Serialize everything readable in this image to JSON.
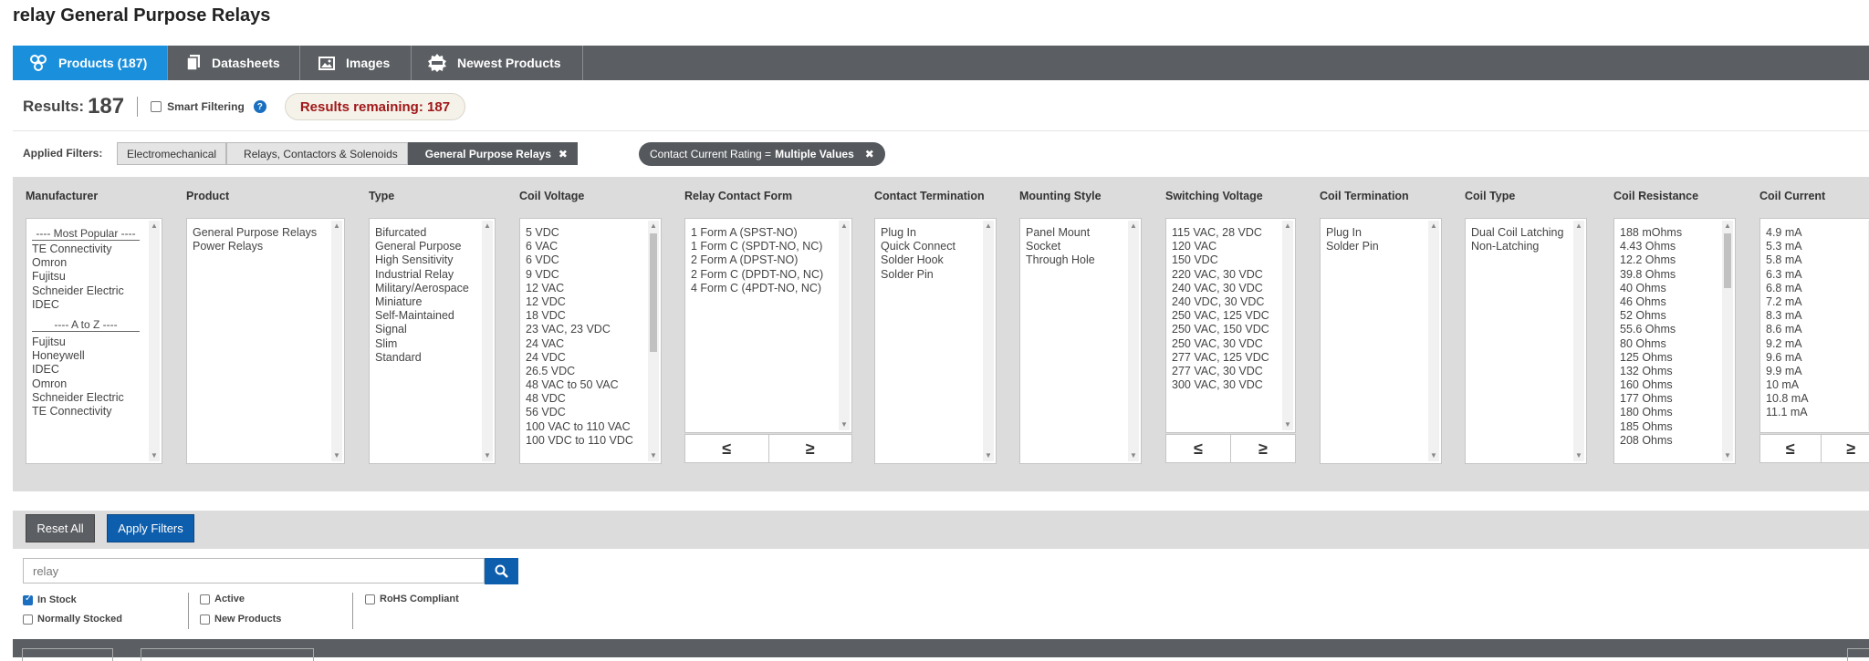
{
  "page": {
    "title": "relay General Purpose Relays"
  },
  "tabs": [
    {
      "label": "Products (187)",
      "icon": "products-icon",
      "active": true
    },
    {
      "label": "Datasheets",
      "icon": "datasheets-icon",
      "active": false
    },
    {
      "label": "Images",
      "icon": "images-icon",
      "active": false
    },
    {
      "label": "Newest Products",
      "icon": "new-badge-icon",
      "active": false
    }
  ],
  "results": {
    "label": "Results:",
    "count": "187",
    "smart_filtering": "Smart Filtering",
    "help": "?",
    "remaining": "Results remaining: 187"
  },
  "applied": {
    "label": "Applied Filters:",
    "crumbs": [
      "Electromechanical",
      "Relays, Contactors & Solenoids",
      "General Purpose Relays"
    ],
    "chip_prefix": "Contact Current Rating =",
    "chip_value": "Multiple Values",
    "remove_glyph": "✖"
  },
  "filters": [
    {
      "name": "Manufacturer",
      "popular_head": "---- Most Popular ----",
      "popular": [
        "TE Connectivity",
        "Omron",
        "Fujitsu",
        "Schneider Electric",
        "IDEC"
      ],
      "az_head": "---- A to Z ----",
      "az": [
        "Fujitsu",
        "Honeywell",
        "IDEC",
        "Omron",
        "Schneider Electric",
        "TE Connectivity"
      ]
    },
    {
      "name": "Product",
      "items": [
        "General Purpose Relays",
        "Power Relays"
      ]
    },
    {
      "name": "Type",
      "items": [
        "Bifurcated",
        "General Purpose",
        "High Sensitivity",
        "Industrial Relay",
        "Military/Aerospace",
        "Miniature",
        "Self-Maintained",
        "Signal",
        "Slim",
        "Standard"
      ]
    },
    {
      "name": "Coil Voltage",
      "items": [
        "5 VDC",
        "6 VAC",
        "6 VDC",
        "9 VDC",
        "12 VAC",
        "12 VDC",
        "18 VDC",
        "23 VAC, 23 VDC",
        "24 VAC",
        "24 VDC",
        "26.5 VDC",
        "48 VAC to 50 VAC",
        "48 VDC",
        "56 VDC",
        "100 VAC to 110 VAC",
        "100 VDC to 110 VDC"
      ]
    },
    {
      "name": "Relay Contact Form",
      "items": [
        "1 Form A (SPST-NO)",
        "1 Form C (SPDT-NO, NC)",
        "2 Form A (DPST-NO)",
        "2 Form C (DPDT-NO, NC)",
        "4 Form C (4PDT-NO, NC)"
      ]
    },
    {
      "name": "Contact Termination",
      "items": [
        "Plug In",
        "Quick Connect",
        "Solder Hook",
        "Solder Pin"
      ]
    },
    {
      "name": "Mounting Style",
      "items": [
        "Panel Mount",
        "Socket",
        "Through Hole"
      ]
    },
    {
      "name": "Switching Voltage",
      "items": [
        "115 VAC, 28 VDC",
        "120 VAC",
        "150 VDC",
        "220 VAC, 30 VDC",
        "240 VAC, 30 VDC",
        "240 VDC, 30 VDC",
        "250 VAC, 125 VDC",
        "250 VAC, 150 VDC",
        "250 VAC, 30 VDC",
        "277 VAC, 125 VDC",
        "277 VAC, 30 VDC",
        "300 VAC, 30 VDC"
      ]
    },
    {
      "name": "Coil Termination",
      "items": [
        "Plug In",
        "Solder Pin"
      ]
    },
    {
      "name": "Coil Type",
      "items": [
        "Dual Coil Latching",
        "Non-Latching"
      ]
    },
    {
      "name": "Coil Resistance",
      "items": [
        "188 mOhms",
        "4.43 Ohms",
        "12.2 Ohms",
        "39.8 Ohms",
        "40 Ohms",
        "46 Ohms",
        "52 Ohms",
        "55.6 Ohms",
        "80 Ohms",
        "125 Ohms",
        "132 Ohms",
        "160 Ohms",
        "177 Ohms",
        "180 Ohms",
        "185 Ohms",
        "208 Ohms"
      ]
    },
    {
      "name": "Coil Current",
      "items": [
        "4.9 mA",
        "5.3 mA",
        "5.8 mA",
        "6.3 mA",
        "6.8 mA",
        "7.2 mA",
        "8.3 mA",
        "8.6 mA",
        "9.2 mA",
        "9.6 mA",
        "9.9 mA",
        "10 mA",
        "10.8 mA",
        "11.1 mA"
      ]
    }
  ],
  "range": {
    "lte": "≤",
    "gte": "≥"
  },
  "buttons": {
    "reset": "Reset All",
    "apply": "Apply Filters"
  },
  "search": {
    "value": "relay",
    "options": [
      {
        "label": "In Stock",
        "checked": true
      },
      {
        "label": "Normally Stocked",
        "checked": false
      },
      {
        "label": "Active",
        "checked": false
      },
      {
        "label": "New Products",
        "checked": false
      },
      {
        "label": "RoHS Compliant",
        "checked": false
      }
    ]
  }
}
